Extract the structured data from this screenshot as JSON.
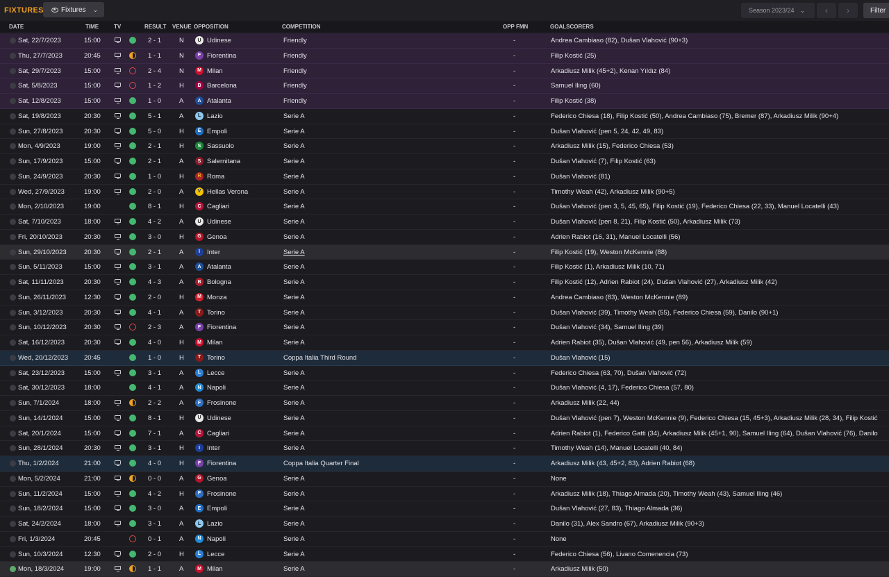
{
  "page": {
    "title": "FIXTURES",
    "view_button": "Fixtures",
    "season": "Season 2023/24",
    "filter": "Filter"
  },
  "columns": {
    "date": "DATE",
    "time": "TIME",
    "tv": "TV",
    "result": "RESULT",
    "venue": "VENUE",
    "opposition": "OPPOSITION",
    "competition": "COMPETITION",
    "opp_fmn": "OPP FMN",
    "goalscorers": "GOALSCORERS"
  },
  "colors": {
    "accent": "#f0a020",
    "win": "#45b870",
    "draw": "#f2a322",
    "loss": "#e04848",
    "friendly_row": "#2e2138",
    "cup_row": "#1e2b3a"
  },
  "fixtures": [
    {
      "date": "Sat, 22/7/2023",
      "time": "15:00",
      "tv": true,
      "outcome": "win",
      "result": "2 - 1",
      "venue": "N",
      "opp": "Udinese",
      "badge_bg": "#e8e8e8",
      "badge_fg": "#222",
      "badge_txt": "U",
      "comp": "Friendly",
      "fmn": "-",
      "scorers": "Andrea Cambiaso (82), Dušan Vlahović (90+3)",
      "type": "friendly",
      "done": false
    },
    {
      "date": "Thu, 27/7/2023",
      "time": "20:45",
      "tv": true,
      "outcome": "draw",
      "result": "1 - 1",
      "venue": "N",
      "opp": "Fiorentina",
      "badge_bg": "#7a3fa8",
      "badge_fg": "#fff",
      "badge_txt": "F",
      "comp": "Friendly",
      "fmn": "-",
      "scorers": "Filip Kostić (25)",
      "type": "friendly",
      "done": false
    },
    {
      "date": "Sat, 29/7/2023",
      "time": "15:00",
      "tv": true,
      "outcome": "loss",
      "result": "2 - 4",
      "venue": "N",
      "opp": "Milan",
      "badge_bg": "#c8102e",
      "badge_fg": "#fff",
      "badge_txt": "M",
      "comp": "Friendly",
      "fmn": "-",
      "scorers": "Arkadiusz Milik (45+2), Kenan Yıldız (84)",
      "type": "friendly",
      "done": false
    },
    {
      "date": "Sat, 5/8/2023",
      "time": "15:00",
      "tv": true,
      "outcome": "loss",
      "result": "1 - 2",
      "venue": "H",
      "opp": "Barcelona",
      "badge_bg": "#a50044",
      "badge_fg": "#fff",
      "badge_txt": "B",
      "comp": "Friendly",
      "fmn": "-",
      "scorers": "Samuel Iling (60)",
      "type": "friendly",
      "done": false
    },
    {
      "date": "Sat, 12/8/2023",
      "time": "15:00",
      "tv": true,
      "outcome": "win",
      "result": "1 - 0",
      "venue": "A",
      "opp": "Atalanta",
      "badge_bg": "#1d4f9a",
      "badge_fg": "#fff",
      "badge_txt": "A",
      "comp": "Friendly",
      "fmn": "-",
      "scorers": "Filip Kostić (38)",
      "type": "friendly",
      "done": false
    },
    {
      "date": "Sat, 19/8/2023",
      "time": "20:30",
      "tv": true,
      "outcome": "win",
      "result": "5 - 1",
      "venue": "A",
      "opp": "Lazio",
      "badge_bg": "#8fc8ec",
      "badge_fg": "#123",
      "badge_txt": "L",
      "comp": "Serie A",
      "fmn": "-",
      "scorers": "Federico Chiesa (18), Filip Kostić (50), Andrea Cambiaso (75), Bremer (87), Arkadiusz Milik (90+4)",
      "type": "league",
      "done": false
    },
    {
      "date": "Sun, 27/8/2023",
      "time": "20:30",
      "tv": true,
      "outcome": "win",
      "result": "5 - 0",
      "venue": "H",
      "opp": "Empoli",
      "badge_bg": "#1f6fc5",
      "badge_fg": "#fff",
      "badge_txt": "E",
      "comp": "Serie A",
      "fmn": "-",
      "scorers": "Dušan Vlahović (pen 5, 24, 42, 49, 83)",
      "type": "league",
      "done": false
    },
    {
      "date": "Mon, 4/9/2023",
      "time": "19:00",
      "tv": true,
      "outcome": "win",
      "result": "2 - 1",
      "venue": "H",
      "opp": "Sassuolo",
      "badge_bg": "#1c8a3c",
      "badge_fg": "#fff",
      "badge_txt": "S",
      "comp": "Serie A",
      "fmn": "-",
      "scorers": "Arkadiusz Milik (15), Federico Chiesa (53)",
      "type": "league",
      "done": false
    },
    {
      "date": "Sun, 17/9/2023",
      "time": "15:00",
      "tv": true,
      "outcome": "win",
      "result": "2 - 1",
      "venue": "A",
      "opp": "Salernitana",
      "badge_bg": "#8a1c2c",
      "badge_fg": "#fff",
      "badge_txt": "S",
      "comp": "Serie A",
      "fmn": "-",
      "scorers": "Dušan Vlahović (7), Filip Kostić (63)",
      "type": "league",
      "done": false
    },
    {
      "date": "Sun, 24/9/2023",
      "time": "20:30",
      "tv": true,
      "outcome": "win",
      "result": "1 - 0",
      "venue": "H",
      "opp": "Roma",
      "badge_bg": "#a8242f",
      "badge_fg": "#f3b61f",
      "badge_txt": "R",
      "comp": "Serie A",
      "fmn": "-",
      "scorers": "Dušan Vlahović (81)",
      "type": "league",
      "done": false
    },
    {
      "date": "Wed, 27/9/2023",
      "time": "19:00",
      "tv": true,
      "outcome": "win",
      "result": "2 - 0",
      "venue": "A",
      "opp": "Hellas Verona",
      "badge_bg": "#f3c200",
      "badge_fg": "#123a7a",
      "badge_txt": "V",
      "comp": "Serie A",
      "fmn": "-",
      "scorers": "Timothy Weah (42), Arkadiusz Milik (90+5)",
      "type": "league",
      "done": false
    },
    {
      "date": "Mon, 2/10/2023",
      "time": "19:00",
      "tv": false,
      "outcome": "win",
      "result": "8 - 1",
      "venue": "H",
      "opp": "Cagliari",
      "badge_bg": "#b8143a",
      "badge_fg": "#fff",
      "badge_txt": "C",
      "comp": "Serie A",
      "fmn": "-",
      "scorers": "Dušan Vlahović (pen 3, 5, 45, 65), Filip Kostić (19), Federico Chiesa (22, 33), Manuel Locatelli (43)",
      "type": "league",
      "done": false
    },
    {
      "date": "Sat, 7/10/2023",
      "time": "18:00",
      "tv": true,
      "outcome": "win",
      "result": "4 - 2",
      "venue": "A",
      "opp": "Udinese",
      "badge_bg": "#e8e8e8",
      "badge_fg": "#222",
      "badge_txt": "U",
      "comp": "Serie A",
      "fmn": "-",
      "scorers": "Dušan Vlahović (pen 8, 21), Filip Kostić (50), Arkadiusz Milik (73)",
      "type": "league",
      "done": false
    },
    {
      "date": "Fri, 20/10/2023",
      "time": "20:30",
      "tv": true,
      "outcome": "win",
      "result": "3 - 0",
      "venue": "H",
      "opp": "Genoa",
      "badge_bg": "#b5152b",
      "badge_fg": "#fff",
      "badge_txt": "G",
      "comp": "Serie A",
      "fmn": "-",
      "scorers": "Adrien Rabiot (16, 31), Manuel Locatelli (56)",
      "type": "league",
      "done": false
    },
    {
      "date": "Sun, 29/10/2023",
      "time": "20:30",
      "tv": true,
      "outcome": "win",
      "result": "2 - 1",
      "venue": "A",
      "opp": "Inter",
      "badge_bg": "#1d3f9a",
      "badge_fg": "#fff",
      "badge_txt": "I",
      "comp": "Serie A",
      "fmn": "-",
      "scorers": "Filip Kostić (19), Weston McKennie (88)",
      "type": "league",
      "done": false,
      "hl": true
    },
    {
      "date": "Sun, 5/11/2023",
      "time": "15:00",
      "tv": true,
      "outcome": "win",
      "result": "3 - 1",
      "venue": "A",
      "opp": "Atalanta",
      "badge_bg": "#1d4f9a",
      "badge_fg": "#fff",
      "badge_txt": "A",
      "comp": "Serie A",
      "fmn": "-",
      "scorers": "Filip Kostić (1), Arkadiusz Milik (10, 71)",
      "type": "league",
      "done": false
    },
    {
      "date": "Sat, 11/11/2023",
      "time": "20:30",
      "tv": true,
      "outcome": "win",
      "result": "4 - 3",
      "venue": "A",
      "opp": "Bologna",
      "badge_bg": "#a81c2c",
      "badge_fg": "#fff",
      "badge_txt": "B",
      "comp": "Serie A",
      "fmn": "-",
      "scorers": "Filip Kostić (12), Adrien Rabiot (24), Dušan Vlahović (27), Arkadiusz Milik (42)",
      "type": "league",
      "done": false
    },
    {
      "date": "Sun, 26/11/2023",
      "time": "12:30",
      "tv": true,
      "outcome": "win",
      "result": "2 - 0",
      "venue": "H",
      "opp": "Monza",
      "badge_bg": "#d2202e",
      "badge_fg": "#fff",
      "badge_txt": "M",
      "comp": "Serie A",
      "fmn": "-",
      "scorers": "Andrea Cambiaso (83), Weston McKennie (89)",
      "type": "league",
      "done": false
    },
    {
      "date": "Sun, 3/12/2023",
      "time": "20:30",
      "tv": true,
      "outcome": "win",
      "result": "4 - 1",
      "venue": "A",
      "opp": "Torino",
      "badge_bg": "#8a1a1a",
      "badge_fg": "#fff",
      "badge_txt": "T",
      "comp": "Serie A",
      "fmn": "-",
      "scorers": "Dušan Vlahović (39), Timothy Weah (55), Federico Chiesa (59), Danilo (90+1)",
      "type": "league",
      "done": false
    },
    {
      "date": "Sun, 10/12/2023",
      "time": "20:30",
      "tv": true,
      "outcome": "loss",
      "result": "2 - 3",
      "venue": "A",
      "opp": "Fiorentina",
      "badge_bg": "#7a3fa8",
      "badge_fg": "#fff",
      "badge_txt": "F",
      "comp": "Serie A",
      "fmn": "-",
      "scorers": "Dušan Vlahović (34), Samuel Iling (39)",
      "type": "league",
      "done": false
    },
    {
      "date": "Sat, 16/12/2023",
      "time": "20:30",
      "tv": true,
      "outcome": "win",
      "result": "4 - 0",
      "venue": "H",
      "opp": "Milan",
      "badge_bg": "#c8102e",
      "badge_fg": "#fff",
      "badge_txt": "M",
      "comp": "Serie A",
      "fmn": "-",
      "scorers": "Adrien Rabiot (35), Dušan Vlahović (49, pen 56), Arkadiusz Milik (59)",
      "type": "league",
      "done": false
    },
    {
      "date": "Wed, 20/12/2023",
      "time": "20:45",
      "tv": false,
      "outcome": "win",
      "result": "1 - 0",
      "venue": "H",
      "opp": "Torino",
      "badge_bg": "#8a1a1a",
      "badge_fg": "#fff",
      "badge_txt": "T",
      "comp": "Coppa Italia Third Round",
      "fmn": "-",
      "scorers": "Dušan Vlahović (15)",
      "type": "cup",
      "done": false
    },
    {
      "date": "Sat, 23/12/2023",
      "time": "15:00",
      "tv": true,
      "outcome": "win",
      "result": "3 - 1",
      "venue": "A",
      "opp": "Lecce",
      "badge_bg": "#2b7fd4",
      "badge_fg": "#fff",
      "badge_txt": "L",
      "comp": "Serie A",
      "fmn": "-",
      "scorers": "Federico Chiesa (63, 70), Dušan Vlahović (72)",
      "type": "league",
      "done": false
    },
    {
      "date": "Sat, 30/12/2023",
      "time": "18:00",
      "tv": false,
      "outcome": "win",
      "result": "4 - 1",
      "venue": "A",
      "opp": "Napoli",
      "badge_bg": "#1e8ad8",
      "badge_fg": "#fff",
      "badge_txt": "N",
      "comp": "Serie A",
      "fmn": "-",
      "scorers": "Dušan Vlahović (4, 17), Federico Chiesa (57, 80)",
      "type": "league",
      "done": false
    },
    {
      "date": "Sun, 7/1/2024",
      "time": "18:00",
      "tv": true,
      "outcome": "draw",
      "result": "2 - 2",
      "venue": "A",
      "opp": "Frosinone",
      "badge_bg": "#2d6fc2",
      "badge_fg": "#fff",
      "badge_txt": "F",
      "comp": "Serie A",
      "fmn": "-",
      "scorers": "Arkadiusz Milik (22, 44)",
      "type": "league",
      "done": false
    },
    {
      "date": "Sun, 14/1/2024",
      "time": "15:00",
      "tv": true,
      "outcome": "win",
      "result": "8 - 1",
      "venue": "H",
      "opp": "Udinese",
      "badge_bg": "#e8e8e8",
      "badge_fg": "#222",
      "badge_txt": "U",
      "comp": "Serie A",
      "fmn": "-",
      "scorers": "Dušan Vlahović (pen 7), Weston McKennie (9), Federico Chiesa (15, 45+3), Arkadiusz Milik (28, 34), Filip Kostić",
      "type": "league",
      "done": false
    },
    {
      "date": "Sat, 20/1/2024",
      "time": "15:00",
      "tv": true,
      "outcome": "win",
      "result": "7 - 1",
      "venue": "A",
      "opp": "Cagliari",
      "badge_bg": "#b8143a",
      "badge_fg": "#fff",
      "badge_txt": "C",
      "comp": "Serie A",
      "fmn": "-",
      "scorers": "Adrien Rabiot (1), Federico Gatti (34), Arkadiusz Milik (45+1, 90), Samuel Iling (64), Dušan Vlahović (76), Danilo",
      "type": "league",
      "done": false
    },
    {
      "date": "Sun, 28/1/2024",
      "time": "20:30",
      "tv": true,
      "outcome": "win",
      "result": "3 - 1",
      "venue": "H",
      "opp": "Inter",
      "badge_bg": "#1d3f9a",
      "badge_fg": "#fff",
      "badge_txt": "I",
      "comp": "Serie A",
      "fmn": "-",
      "scorers": "Timothy Weah (14), Manuel Locatelli (40, 84)",
      "type": "league",
      "done": false
    },
    {
      "date": "Thu, 1/2/2024",
      "time": "21:00",
      "tv": true,
      "outcome": "win",
      "result": "4 - 0",
      "venue": "H",
      "opp": "Fiorentina",
      "badge_bg": "#7a3fa8",
      "badge_fg": "#fff",
      "badge_txt": "F",
      "comp": "Coppa Italia Quarter Final",
      "fmn": "-",
      "scorers": "Arkadiusz Milik (43, 45+2, 83), Adrien Rabiot (68)",
      "type": "cup",
      "done": false
    },
    {
      "date": "Mon, 5/2/2024",
      "time": "21:00",
      "tv": true,
      "outcome": "draw",
      "result": "0 - 0",
      "venue": "A",
      "opp": "Genoa",
      "badge_bg": "#b5152b",
      "badge_fg": "#fff",
      "badge_txt": "G",
      "comp": "Serie A",
      "fmn": "-",
      "scorers": "None",
      "type": "league",
      "done": false
    },
    {
      "date": "Sun, 11/2/2024",
      "time": "15:00",
      "tv": true,
      "outcome": "win",
      "result": "4 - 2",
      "venue": "H",
      "opp": "Frosinone",
      "badge_bg": "#2d6fc2",
      "badge_fg": "#fff",
      "badge_txt": "F",
      "comp": "Serie A",
      "fmn": "-",
      "scorers": "Arkadiusz Milik (18), Thiago Almada (20), Timothy Weah (43), Samuel Iling (46)",
      "type": "league",
      "done": false
    },
    {
      "date": "Sun, 18/2/2024",
      "time": "15:00",
      "tv": true,
      "outcome": "win",
      "result": "3 - 0",
      "venue": "A",
      "opp": "Empoli",
      "badge_bg": "#1f6fc5",
      "badge_fg": "#fff",
      "badge_txt": "E",
      "comp": "Serie A",
      "fmn": "-",
      "scorers": "Dušan Vlahović (27, 83), Thiago Almada (36)",
      "type": "league",
      "done": false
    },
    {
      "date": "Sat, 24/2/2024",
      "time": "18:00",
      "tv": true,
      "outcome": "win",
      "result": "3 - 1",
      "venue": "A",
      "opp": "Lazio",
      "badge_bg": "#8fc8ec",
      "badge_fg": "#123",
      "badge_txt": "L",
      "comp": "Serie A",
      "fmn": "-",
      "scorers": "Danilo (31), Alex Sandro (67), Arkadiusz Milik (90+3)",
      "type": "league",
      "done": false
    },
    {
      "date": "Fri, 1/3/2024",
      "time": "20:45",
      "tv": false,
      "outcome": "loss",
      "result": "0 - 1",
      "venue": "A",
      "opp": "Napoli",
      "badge_bg": "#1e8ad8",
      "badge_fg": "#fff",
      "badge_txt": "N",
      "comp": "Serie A",
      "fmn": "-",
      "scorers": "None",
      "type": "league",
      "done": false
    },
    {
      "date": "Sun, 10/3/2024",
      "time": "12:30",
      "tv": true,
      "outcome": "win",
      "result": "2 - 0",
      "venue": "H",
      "opp": "Lecce",
      "badge_bg": "#2b7fd4",
      "badge_fg": "#fff",
      "badge_txt": "L",
      "comp": "Serie A",
      "fmn": "-",
      "scorers": "Federico Chiesa (56), Livano Comenencia (73)",
      "type": "league",
      "done": false
    },
    {
      "date": "Mon, 18/3/2024",
      "time": "19:00",
      "tv": true,
      "outcome": "draw",
      "result": "1 - 1",
      "venue": "A",
      "opp": "Milan",
      "badge_bg": "#c8102e",
      "badge_fg": "#fff",
      "badge_txt": "M",
      "comp": "Serie A",
      "fmn": "-",
      "scorers": "Arkadiusz Milik (50)",
      "type": "league",
      "done": true,
      "hl": true
    }
  ]
}
